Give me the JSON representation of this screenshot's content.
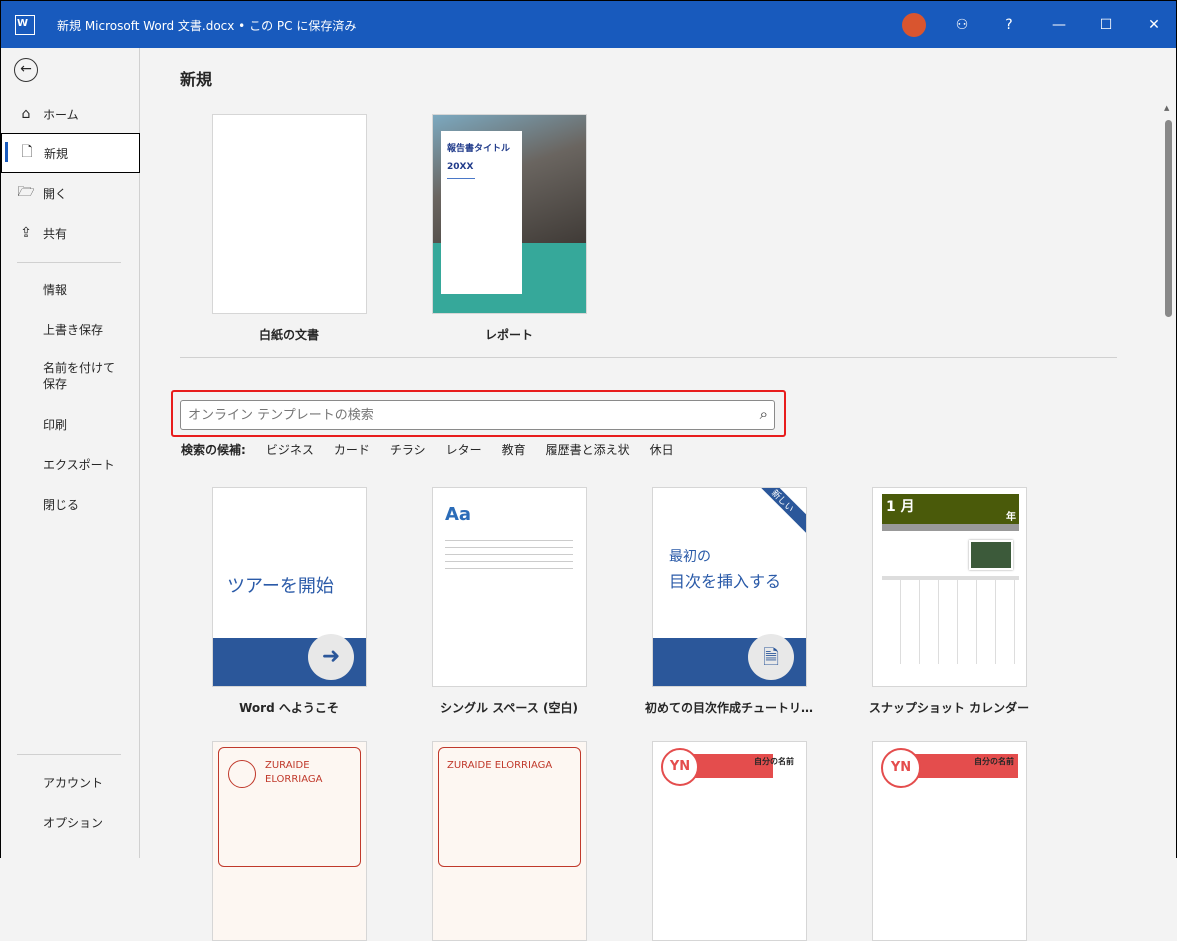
{
  "window": {
    "title": "新規 Microsoft Word 文書.docx • この PC に保存済み",
    "app_icon": "W",
    "help": "?",
    "minimize": "—",
    "maximize": "☐",
    "close": "✕"
  },
  "sidebar": {
    "back": "←",
    "items": [
      {
        "label": "ホーム",
        "icon": "⌂"
      },
      {
        "label": "新規",
        "icon": "🗋"
      },
      {
        "label": "開く",
        "icon": "🗁"
      },
      {
        "label": "共有",
        "icon": "⇪"
      }
    ],
    "secondary": [
      "情報",
      "上書き保存",
      "名前を付けて保存",
      "印刷",
      "エクスポート",
      "閉じる"
    ],
    "bottom": [
      "アカウント",
      "オプション"
    ]
  },
  "main": {
    "heading": "新規",
    "featured": [
      {
        "label": "白紙の文書"
      },
      {
        "label": "レポート",
        "cover_title": "報告書タイトル",
        "cover_year": "20XX"
      }
    ],
    "search": {
      "placeholder": "オンライン テンプレートの検索",
      "icon": "⌕"
    },
    "suggestions_label": "検索の候補:",
    "suggestions": [
      "ビジネス",
      "カード",
      "チラシ",
      "レター",
      "教育",
      "履歴書と添え状",
      "休日"
    ],
    "templates": [
      {
        "label": "Word へようこそ",
        "thumb_text": "ツアーを開始"
      },
      {
        "label": "シングル スペース (空白)",
        "thumb_text": "Aa"
      },
      {
        "label": "初めての目次作成チュートリ…",
        "thumb_line1": "最初の",
        "thumb_line2": "目次を挿入する",
        "badge": "新しい"
      },
      {
        "label": "スナップショット カレンダー",
        "thumb_month": "1 月",
        "thumb_year": "年"
      }
    ],
    "resumes": [
      {
        "name1": "ZURAIDE",
        "name2": "ELORRIAGA"
      },
      {
        "name": "ZURAIDE ELORRIAGA"
      },
      {
        "initials": "YN",
        "title": "自分の名前"
      },
      {
        "initials": "YN",
        "title": "自分の名前"
      }
    ]
  }
}
